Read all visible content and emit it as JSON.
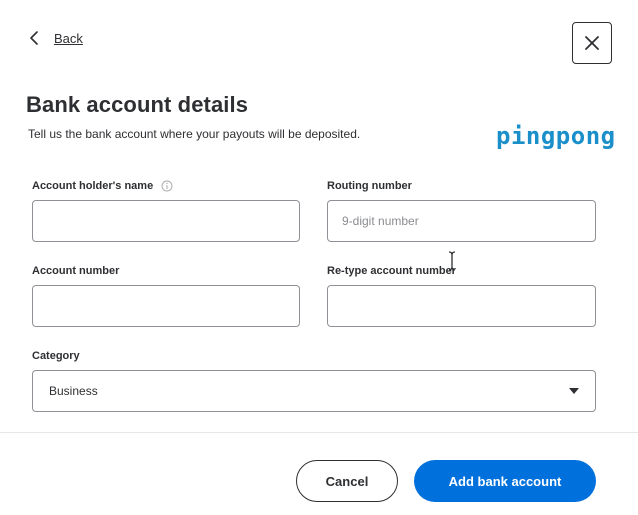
{
  "header": {
    "back_label": "Back",
    "close_icon": "close-icon",
    "back_icon": "chevron-left-icon"
  },
  "title": "Bank account details",
  "subtitle": "Tell us the bank account where your payouts will be deposited.",
  "brand": {
    "name": "pingpong",
    "color": "#1a8fc9"
  },
  "form": {
    "account_holder": {
      "label": "Account holder's name",
      "value": "",
      "placeholder": "",
      "info_icon": "info-icon"
    },
    "routing_number": {
      "label": "Routing number",
      "value": "",
      "placeholder": "9-digit number"
    },
    "account_number": {
      "label": "Account number",
      "value": "",
      "placeholder": ""
    },
    "retype_account_number": {
      "label": "Re-type account number",
      "value": "",
      "placeholder": ""
    },
    "category": {
      "label": "Category",
      "selected": "Business",
      "caret_icon": "caret-down-icon"
    }
  },
  "footer": {
    "cancel_label": "Cancel",
    "submit_label": "Add bank account"
  },
  "colors": {
    "primary": "#0071dc",
    "text": "#2e2f32",
    "border": "#909196"
  }
}
